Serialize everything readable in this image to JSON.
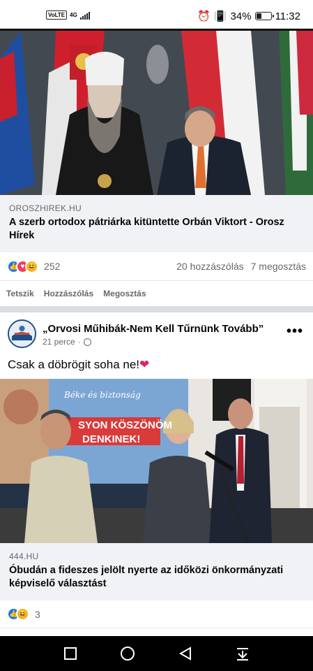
{
  "status_bar": {
    "volte": "VoLTE",
    "network": "4G",
    "battery_percent": "34%",
    "battery_level": 0.34,
    "time": "11:32"
  },
  "post1": {
    "photo_icon": "photo-of-two-men-with-flags",
    "link": {
      "domain": "OROSZHIREK.HU",
      "title": "A szerb ortodox pátriárka kitüntette Orbán Viktort - Orosz Hírek"
    },
    "reactions": {
      "count": "252",
      "comments": "20 hozzászólás",
      "shares": "7 megosztás"
    },
    "actions": {
      "like": "Tetszik",
      "comment": "Hozzászólás",
      "share": "Megosztás"
    }
  },
  "post2": {
    "page_name": "„Orvosi Műhibák-Nem Kell Tűrnünk Tovább”",
    "time": "21 perce",
    "text": "Csak a döbrögit soha ne!",
    "photo_icon": "photo-of-election-event",
    "photo_banner": {
      "line1": "Béke és biztonság",
      "line2": "SYON KÖSZÖNÖM",
      "line3": "DENKINEK!"
    },
    "link": {
      "domain": "444.HU",
      "title": "Óbudán a fideszes jelölt nyerte az időközi önkormányzati képviselő választást"
    },
    "reactions": {
      "count": "3"
    }
  },
  "colors": {
    "facebook_blue": "#1877f2",
    "love_red": "#f33e58",
    "haha_yellow": "#f7b125",
    "link_bg": "#f0f2f5"
  }
}
